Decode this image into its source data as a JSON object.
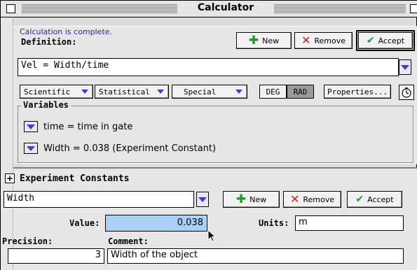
{
  "window": {
    "title": "Calculator"
  },
  "status": {
    "message": "Calculation is complete."
  },
  "definition": {
    "label": "Definition:",
    "expression": "Vel = Width/time"
  },
  "toolbar": {
    "new_label": "New",
    "remove_label": "Remove",
    "accept_label": "Accept"
  },
  "menus": {
    "scientific": "Scientific",
    "statistical": "Statistical",
    "special": "Special",
    "deg": "DEG",
    "rad": "RAD",
    "angle_mode_selected": "RAD",
    "properties": "Properties..."
  },
  "variables": {
    "legend": "Variables",
    "items": [
      {
        "text": "time = time in gate"
      },
      {
        "text": "Width = 0.038 (Experiment Constant)"
      }
    ]
  },
  "constants": {
    "heading": "Experiment Constants",
    "selected": "Width",
    "new_label": "New",
    "remove_label": "Remove",
    "accept_label": "Accept",
    "value_label": "Value:",
    "value": "0.038",
    "units_label": "Units:",
    "units": "m",
    "precision_label": "Precision:",
    "precision": "3",
    "comment_label": "Comment:",
    "comment": "Width of the object"
  },
  "colors": {
    "accent_green": "#1e9a2a",
    "remove_red": "#d61b1b",
    "selection_blue": "#a9d0f5",
    "status_text": "#2b2b90"
  },
  "icons": [
    "close-box-icon",
    "zoom-box-icon",
    "plus-icon",
    "x-icon",
    "checkmark-icon",
    "chevron-down-icon",
    "stopwatch-icon",
    "expand-plus-icon",
    "mouse-pointer-icon"
  ]
}
